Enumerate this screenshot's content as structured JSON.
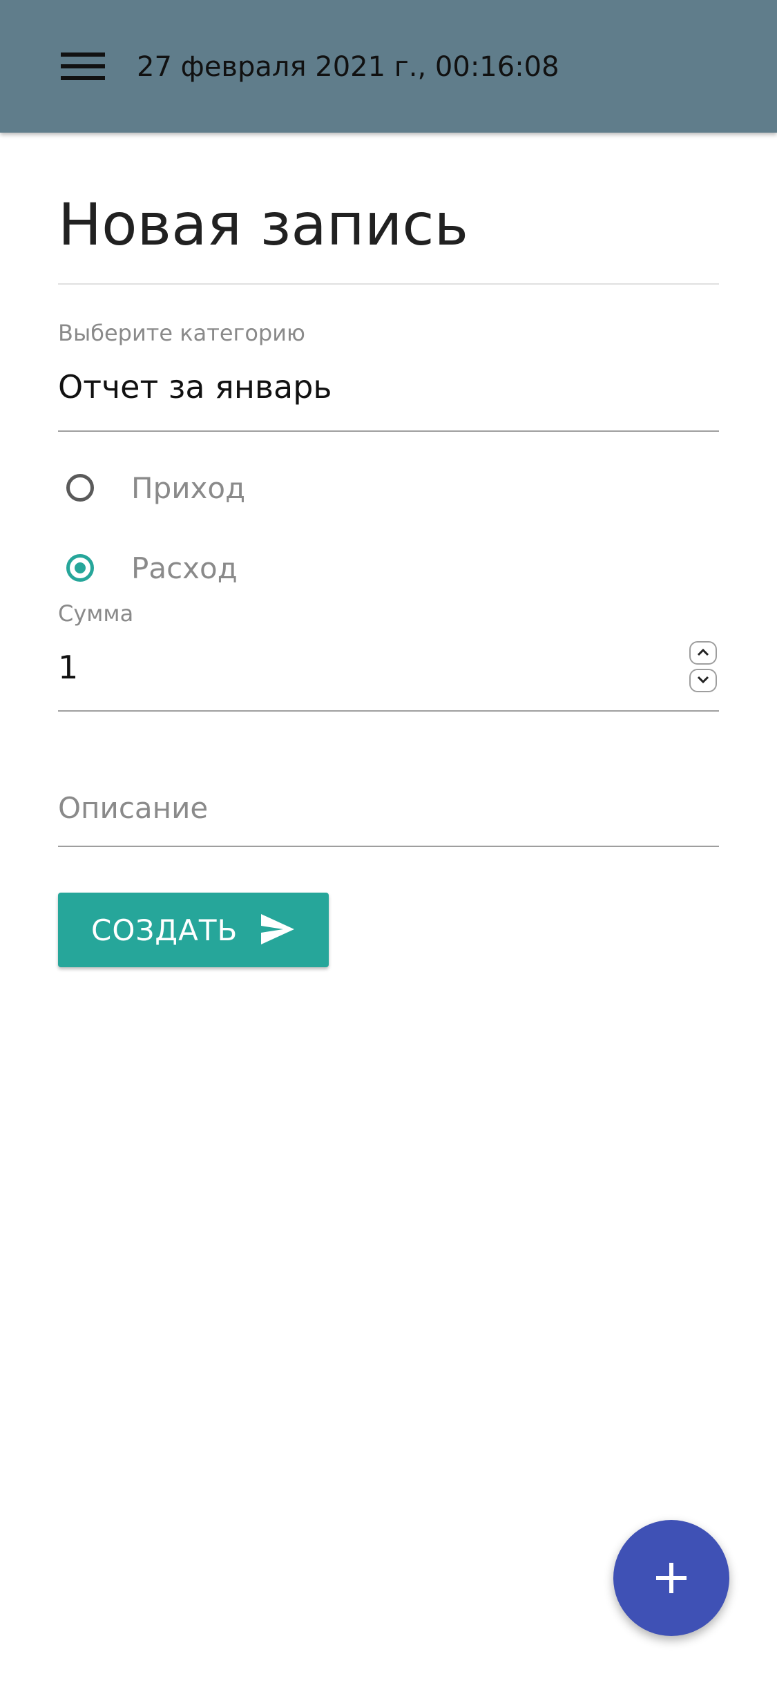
{
  "appbar": {
    "menu_icon": "hamburger-menu-icon",
    "title": "27 февраля 2021 г., 00:16:08",
    "background": "#607d8b"
  },
  "form": {
    "title": "Новая запись",
    "category": {
      "label": "Выберите категорию",
      "value": "Отчет за январь"
    },
    "type_options": [
      {
        "label": "Приход",
        "checked": false
      },
      {
        "label": "Расход",
        "checked": true
      }
    ],
    "amount": {
      "label": "Сумма",
      "value": "1"
    },
    "description": {
      "placeholder": "Описание",
      "value": ""
    },
    "submit": {
      "label": "СОЗДАТЬ",
      "icon": "send-icon"
    }
  },
  "fab": {
    "icon": "plus-icon",
    "color": "#3f51b5"
  },
  "colors": {
    "accent": "#26a69a",
    "appbar": "#607d8b",
    "fab": "#3f51b5"
  }
}
